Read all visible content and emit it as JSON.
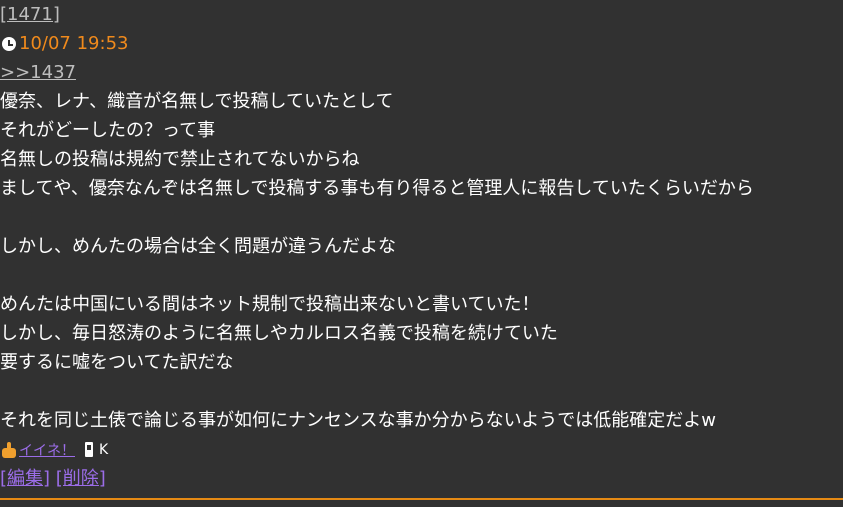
{
  "post": {
    "number": "[1471]",
    "datetime": "10/07 19:53",
    "reply_to": ">>1437",
    "body": [
      "優奈、レナ、織音が名無しで投稿していたとして",
      "それがどーしたの？って事",
      "名無しの投稿は規約で禁止されてないからね",
      "ましてや、優奈なんぞは名無しで投稿する事も有り得ると管理人に報告していたくらいだから",
      "",
      "しかし、めんたの場合は全く問題が違うんだよな",
      "",
      "めんたは中国にいる間はネット規制で投稿出来ないと書いていた！",
      "しかし、毎日怒涛のように名無しやカルロス名義で投稿を続けていた",
      "要するに嘘をついてた訳だな",
      "",
      "それを同じ土俵で論じる事が如何にナンセンスな事か分からないようでは低能確定だよw"
    ],
    "good_label": "イイネ！",
    "user_id": "K",
    "edit_label": "[編集]",
    "delete_label": "[削除]"
  },
  "icons": {
    "clock": "clock-icon",
    "thumb": "thumbs-up-icon",
    "phone": "mobile-phone-icon"
  },
  "colors": {
    "background": "#313131",
    "date": "#f08a1c",
    "link": "#9b6de8",
    "divider": "#e58a14"
  }
}
